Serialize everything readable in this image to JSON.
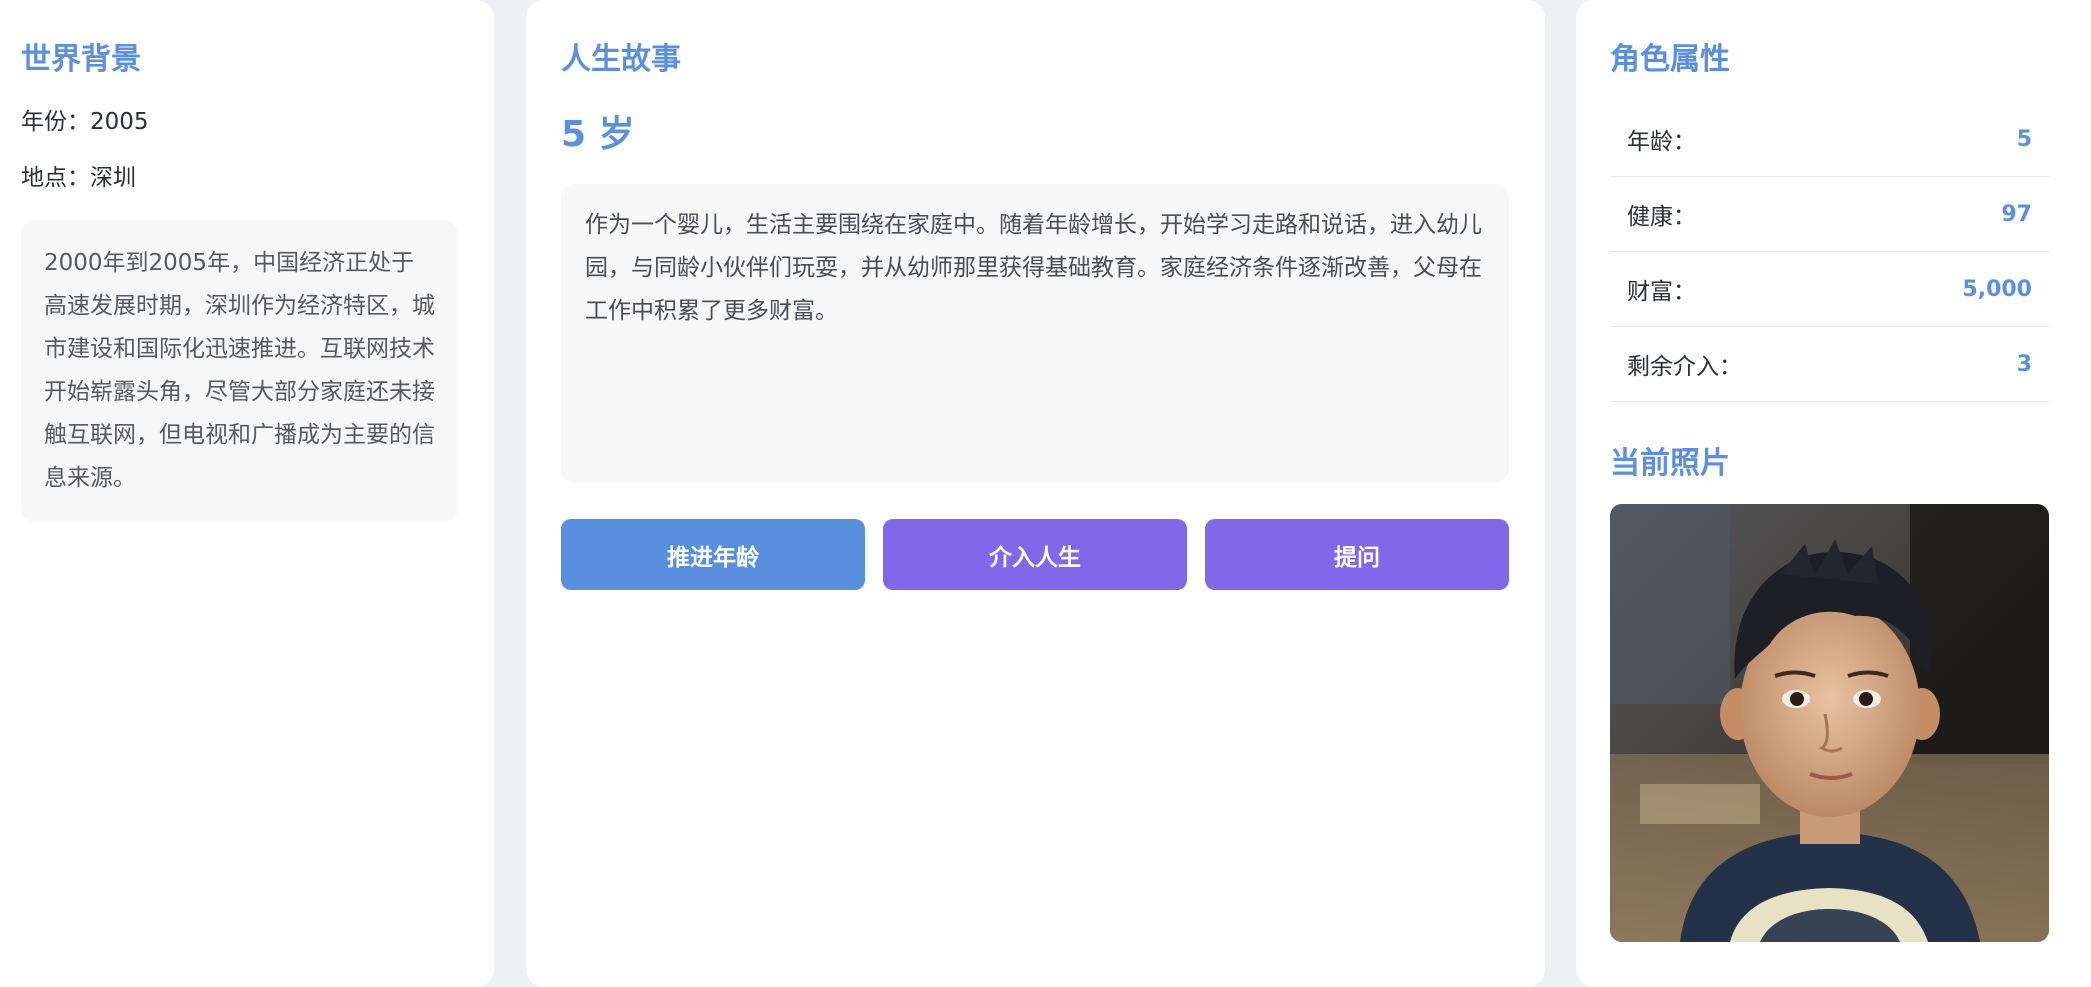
{
  "world": {
    "title": "世界背景",
    "year_label": "年份：",
    "year_value": "2005",
    "place_label": "地点：",
    "place_value": "深圳",
    "description": "2000年到2005年，中国经济正处于高速发展时期，深圳作为经济特区，城市建设和国际化迅速推进。互联网技术开始崭露头角，尽管大部分家庭还未接触互联网，但电视和广播成为主要的信息来源。"
  },
  "story": {
    "title": "人生故事",
    "age_heading": "5 岁",
    "text": "作为一个婴儿，生活主要围绕在家庭中。随着年龄增长，开始学习走路和说话，进入幼儿园，与同龄小伙伴们玩耍，并从幼师那里获得基础教育。家庭经济条件逐渐改善，父母在工作中积累了更多财富。",
    "buttons": {
      "advance": "推进年龄",
      "intervene": "介入人生",
      "ask": "提问"
    }
  },
  "attributes": {
    "title": "角色属性",
    "rows": [
      {
        "label": "年龄：",
        "value": "5"
      },
      {
        "label": "健康：",
        "value": "97"
      },
      {
        "label": "财富：",
        "value": "5,000"
      },
      {
        "label": "剩余介入：",
        "value": "3"
      }
    ]
  },
  "photo": {
    "title": "当前照片",
    "icon": "child-portrait"
  },
  "colors": {
    "accent": "#5b8fe0",
    "button_blue": "#5a8fe0",
    "button_purple": "#8068ea",
    "card_bg": "#f7f7f8",
    "page_bg": "#eef0f4"
  }
}
